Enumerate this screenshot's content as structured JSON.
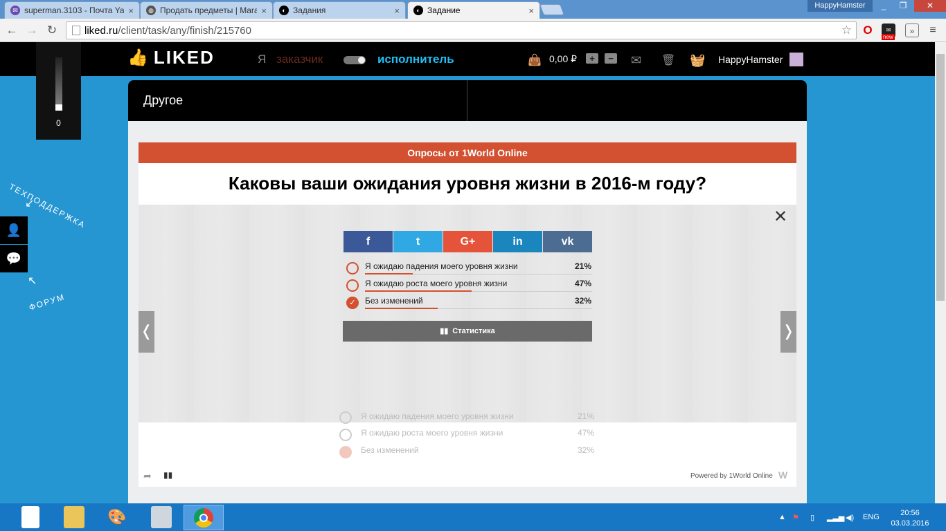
{
  "browser": {
    "tabs": [
      {
        "label": "superman.3103 - Почта Ya",
        "icon": "mail-icon"
      },
      {
        "label": "Продать предметы | Mara",
        "icon": "globe-icon"
      },
      {
        "label": "Задания",
        "icon": "liked-icon"
      },
      {
        "label": "Задание",
        "icon": "liked-icon",
        "active": true
      }
    ],
    "profile_name": "HappyHamster",
    "url_host": "liked.ru",
    "url_path": "/client/task/any/finish/215760",
    "ext_badge": "new"
  },
  "header": {
    "logo": "LIKED",
    "ya": "Я",
    "role_customer": "заказчик",
    "role_performer": "исполнитель",
    "balance": "0,00 ₽",
    "plus": "+",
    "minus": "−",
    "username": "HappyHamster"
  },
  "sidebar": {
    "meter_value": "0",
    "support_label": "ТЕХПОДДЕРЖКА",
    "forum_label": "ФОРУМ"
  },
  "task": {
    "category": "Другое"
  },
  "poll": {
    "header": "Опросы от 1World Online",
    "question": "Каковы ваши ожидания уровня жизни в 2016-м году?",
    "share_buttons": [
      {
        "name": "facebook",
        "glyph": "f",
        "color": "#3b5998"
      },
      {
        "name": "twitter",
        "glyph": "t",
        "color": "#2fa8e3"
      },
      {
        "name": "google-plus",
        "glyph": "G+",
        "color": "#e5533a"
      },
      {
        "name": "linkedin",
        "glyph": "in",
        "color": "#1b85be"
      },
      {
        "name": "vk",
        "glyph": "vk",
        "color": "#4c6c91"
      }
    ],
    "options": [
      {
        "text": "Я ожидаю падения моего уровня жизни",
        "percent": "21%",
        "value": 21,
        "selected": false
      },
      {
        "text": "Я ожидаю роста моего уровня жизни",
        "percent": "47%",
        "value": 47,
        "selected": false
      },
      {
        "text": "Без изменений",
        "percent": "32%",
        "value": 32,
        "selected": true
      }
    ],
    "stats_button": "Статистика",
    "prev": "❬",
    "next": "❭",
    "close": "✕",
    "powered_by": "Powered by 1World Online"
  },
  "taskbar": {
    "lang": "ENG",
    "time": "20:56",
    "date": "03.03.2016"
  },
  "colors": {
    "page_bg": "#2596d2",
    "accent": "#d35030",
    "performer": "#1ec0f5"
  }
}
